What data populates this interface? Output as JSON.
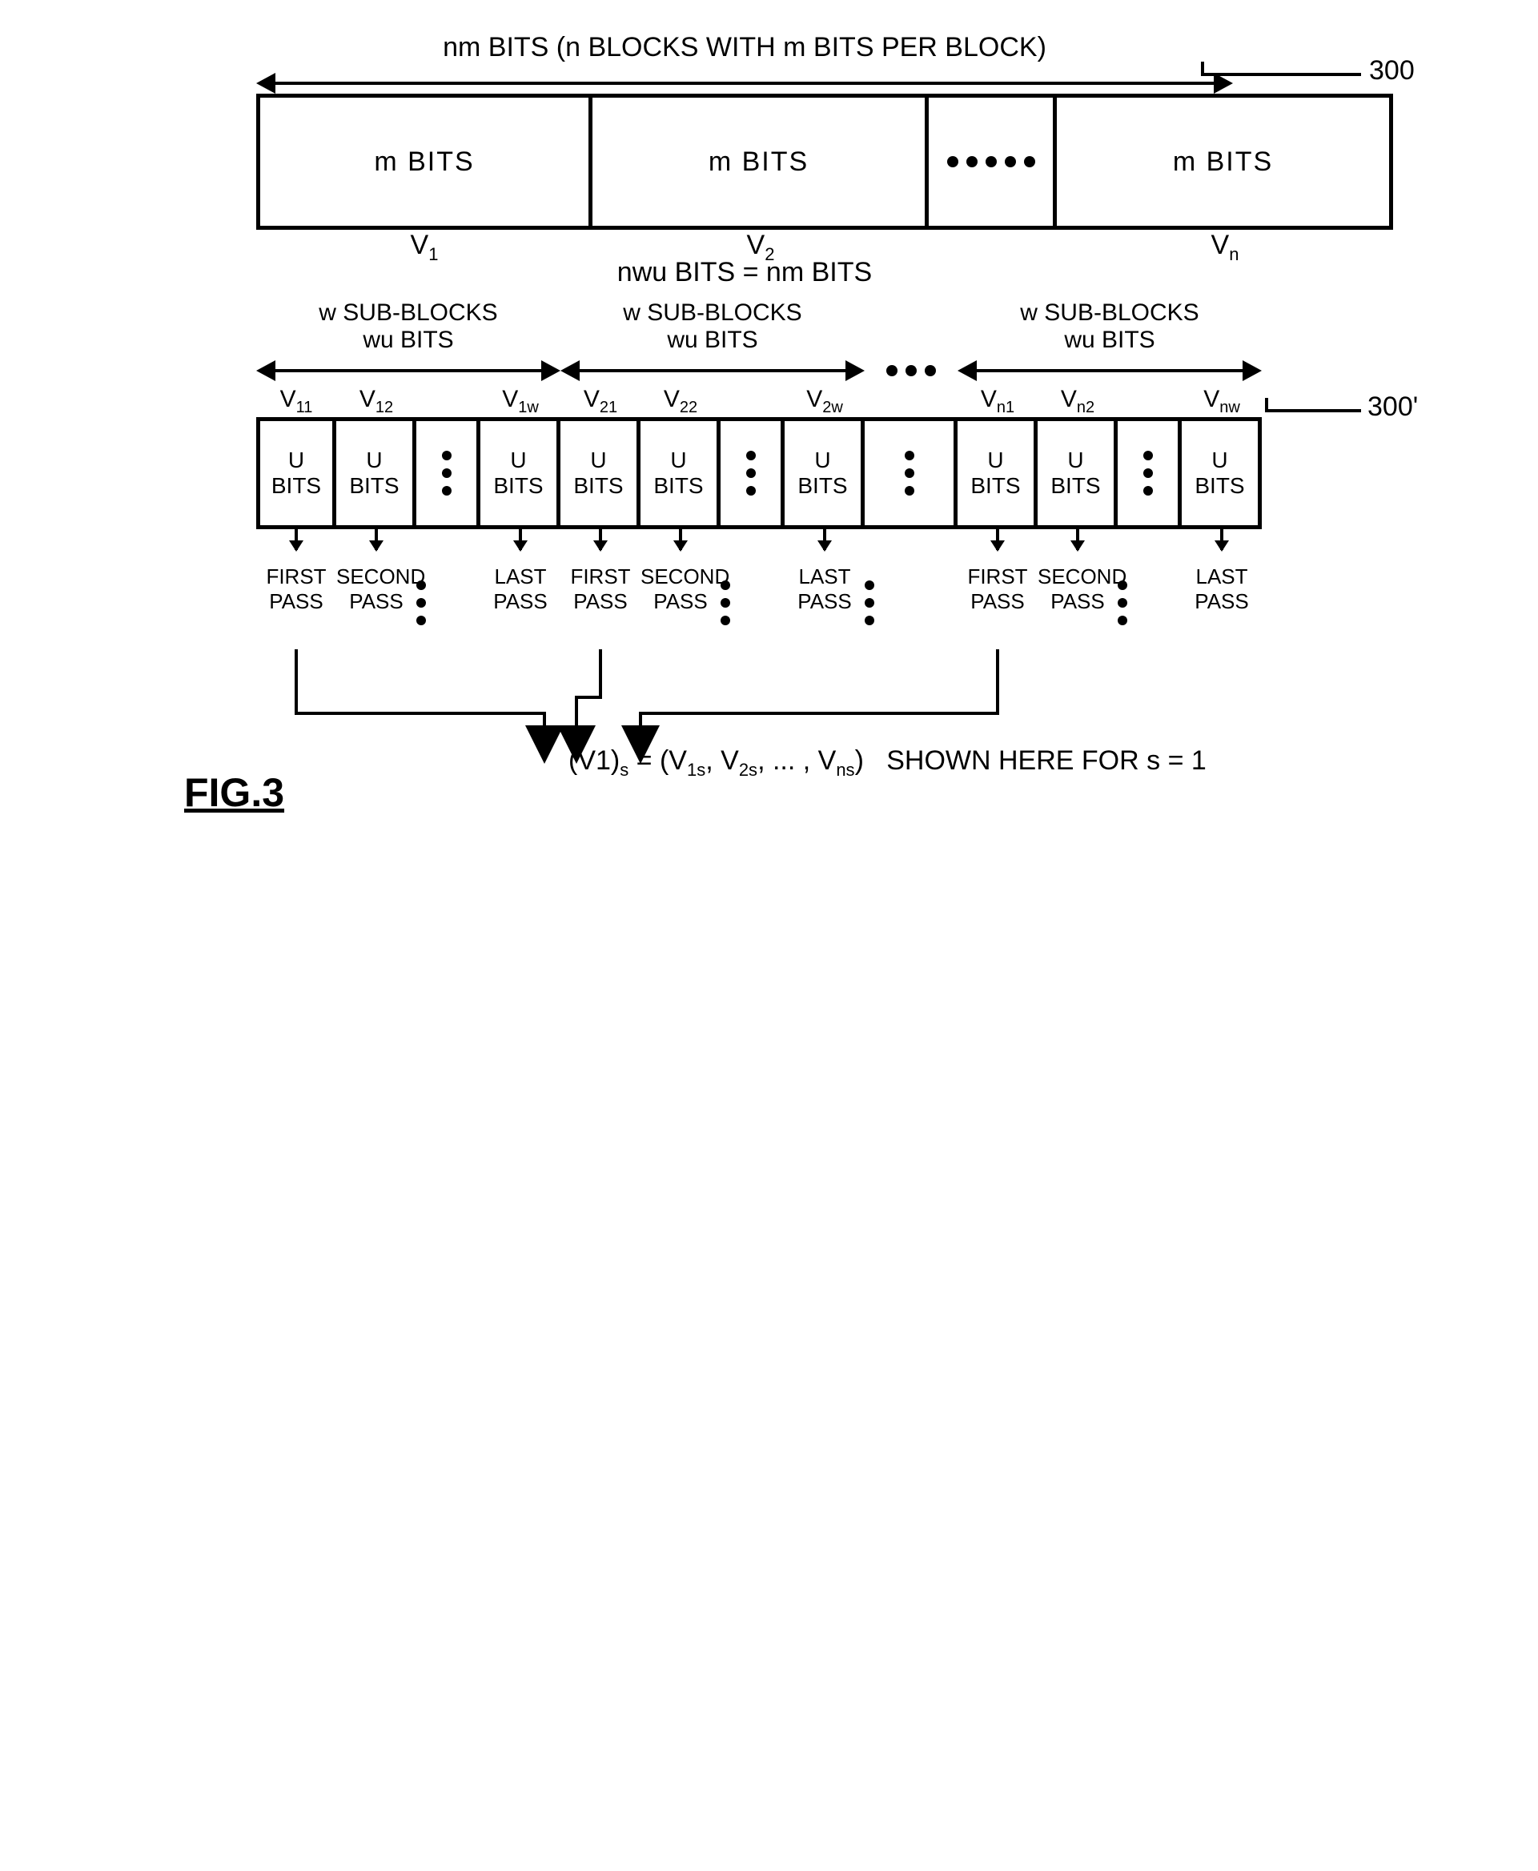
{
  "meta": {
    "figure_label": "FIG.3",
    "ref_300": "300",
    "ref_300p": "300'"
  },
  "top": {
    "dim_label": "nm BITS (n BLOCKS WITH m BITS PER BLOCK)",
    "block_label": "m BITS",
    "v_labels": [
      "V",
      "V",
      "V"
    ],
    "v_subs": [
      "1",
      "2",
      "n"
    ]
  },
  "mid_eq": "nwu BITS = nm BITS",
  "groups": {
    "line1": "w SUB-BLOCKS",
    "line2": "wu BITS"
  },
  "sub": {
    "cell_line1": "U",
    "cell_line2": "BITS",
    "col_base": "V",
    "col_subs": [
      "11",
      "12",
      "1w",
      "21",
      "22",
      "2w",
      "n1",
      "n2",
      "nw"
    ]
  },
  "passes": {
    "first": "FIRST\nPASS",
    "second": "SECOND\nPASS",
    "last": "LAST\nPASS"
  },
  "formula": "(V1)_s = (V_{1s}, V_{2s}, ... , V_{ns})   SHOWN HERE FOR s = 1"
}
